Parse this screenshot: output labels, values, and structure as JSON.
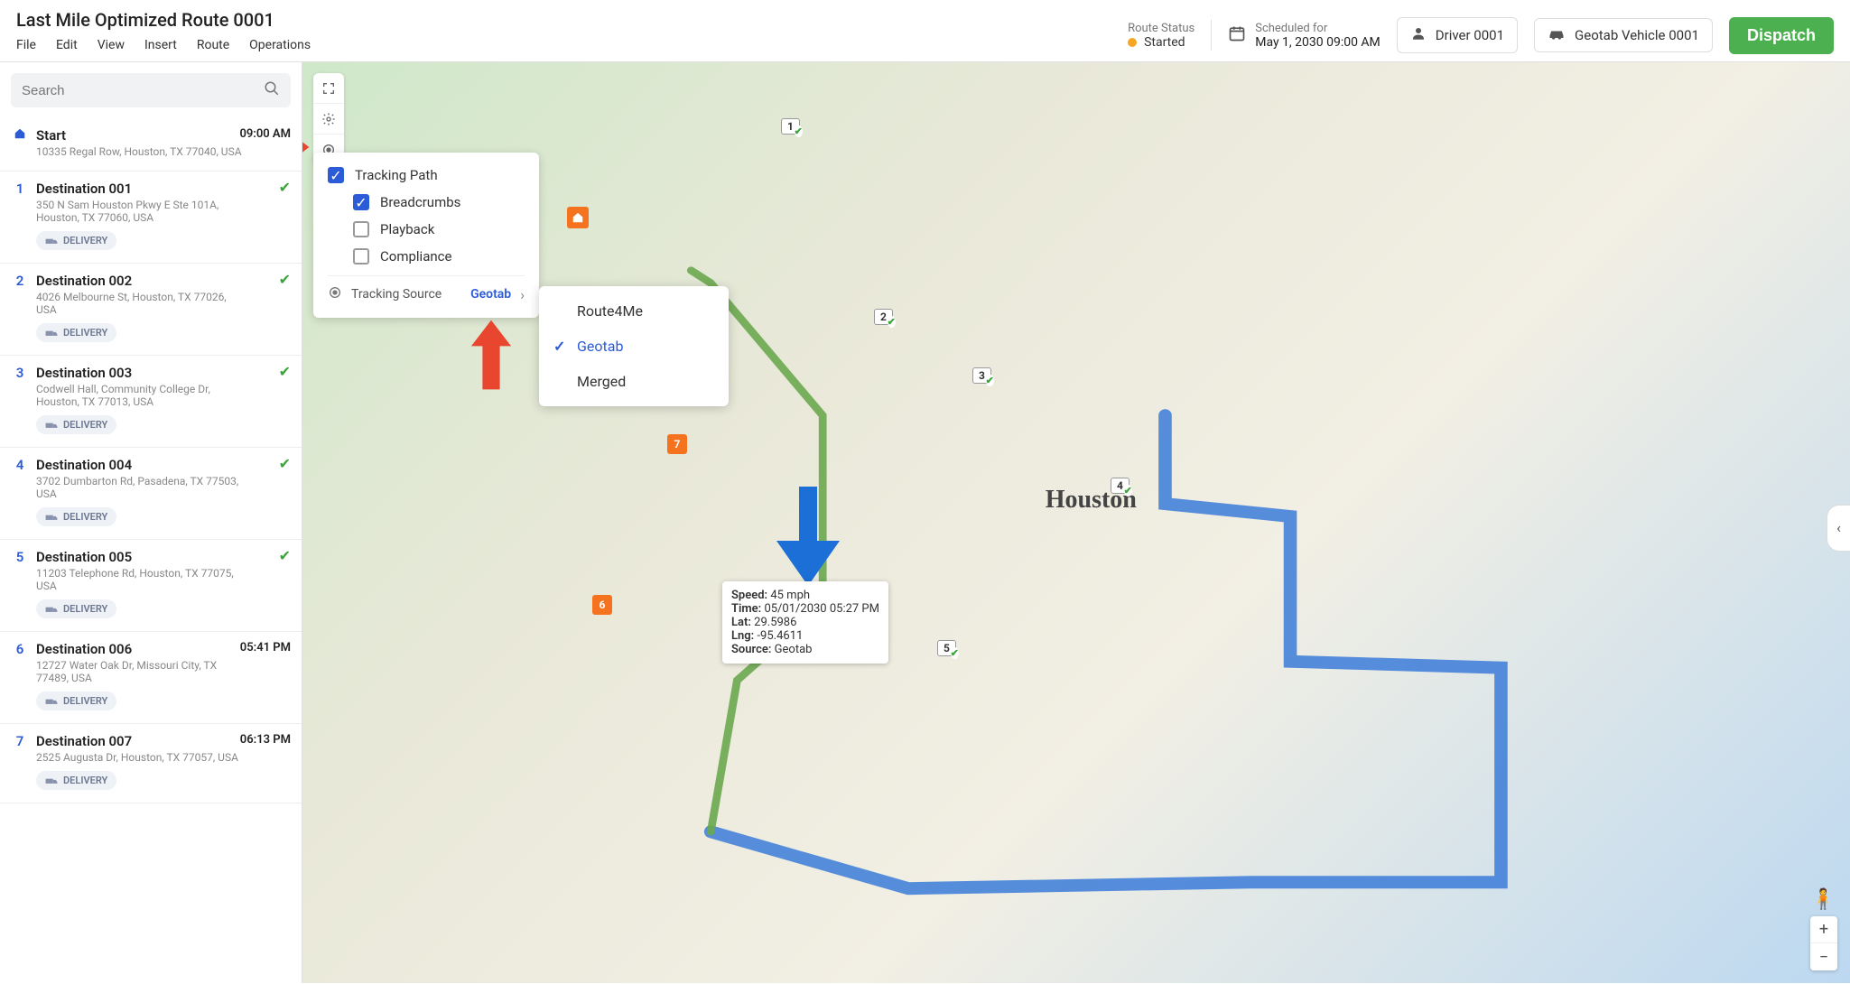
{
  "header": {
    "title": "Last Mile Optimized Route 0001",
    "menu": [
      "File",
      "Edit",
      "View",
      "Insert",
      "Route",
      "Operations"
    ],
    "route_status_label": "Route Status",
    "route_status_value": "Started",
    "scheduled_label": "Scheduled for",
    "scheduled_value": "May 1, 2030 09:00 AM",
    "driver": "Driver 0001",
    "vehicle": "Geotab Vehicle 0001",
    "dispatch": "Dispatch"
  },
  "search": {
    "placeholder": "Search"
  },
  "stops": [
    {
      "idx": "",
      "title": "Start",
      "addr": "10335 Regal Row, Houston, TX 77040, USA",
      "time": "09:00 AM",
      "home": true
    },
    {
      "idx": "1",
      "title": "Destination 001",
      "addr": "350 N Sam Houston Pkwy E Ste 101A, Houston, TX 77060, USA",
      "done": true,
      "pill": "DELIVERY"
    },
    {
      "idx": "2",
      "title": "Destination 002",
      "addr": "4026 Melbourne St, Houston, TX 77026, USA",
      "done": true,
      "pill": "DELIVERY"
    },
    {
      "idx": "3",
      "title": "Destination 003",
      "addr": "Codwell Hall, Community College Dr, Houston, TX 77013, USA",
      "done": true,
      "pill": "DELIVERY"
    },
    {
      "idx": "4",
      "title": "Destination 004",
      "addr": "3702 Dumbarton Rd, Pasadena, TX 77503, USA",
      "done": true,
      "pill": "DELIVERY"
    },
    {
      "idx": "5",
      "title": "Destination 005",
      "addr": "11203 Telephone Rd, Houston, TX 77075, USA",
      "done": true,
      "pill": "DELIVERY"
    },
    {
      "idx": "6",
      "title": "Destination 006",
      "addr": "12727 Water Oak Dr, Missouri City, TX 77489, USA",
      "time": "05:41 PM",
      "pill": "DELIVERY"
    },
    {
      "idx": "7",
      "title": "Destination 007",
      "addr": "2525 Augusta Dr, Houston, TX 77057, USA",
      "time": "06:13 PM",
      "pill": "DELIVERY"
    }
  ],
  "tracking_panel": {
    "tracking_path": "Tracking Path",
    "breadcrumbs": "Breadcrumbs",
    "playback": "Playback",
    "compliance": "Compliance",
    "source_label": "Tracking Source",
    "source_value": "Geotab"
  },
  "source_menu": [
    "Route4Me",
    "Geotab",
    "Merged"
  ],
  "source_selected": "Geotab",
  "breadcrumb_tooltip": {
    "speed_label": "Speed:",
    "speed": "45 mph",
    "time_label": "Time:",
    "time": "05/01/2030 05:27 PM",
    "lat_label": "Lat:",
    "lat": "29.5986",
    "lng_label": "Lng:",
    "lng": "-95.4611",
    "source_label": "Source:",
    "source": "Geotab"
  },
  "map": {
    "city_label": "Houston"
  }
}
